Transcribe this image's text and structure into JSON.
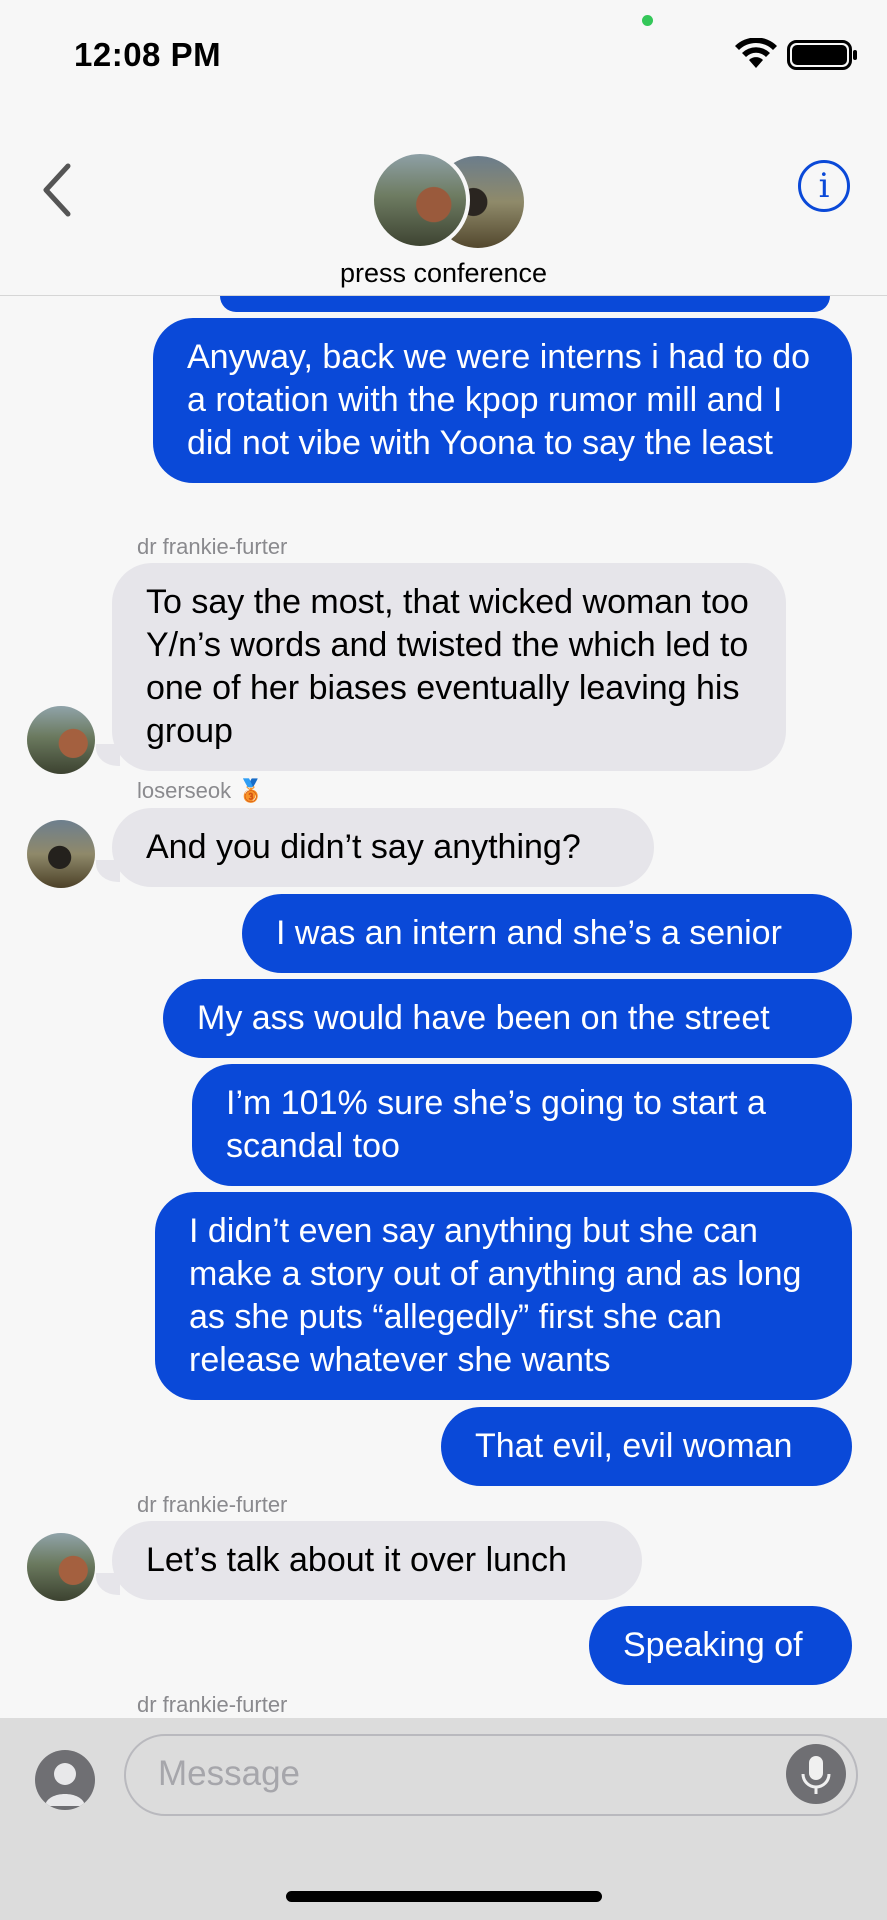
{
  "status": {
    "time": "12:08 PM"
  },
  "header": {
    "group_name": "press conference"
  },
  "messages": [
    {
      "text": "Anyway, back we were interns i had to do a rotation with the kpop rumor mill and I did not vibe with Yoona to say the least"
    },
    {
      "sender": "dr frankie-furter",
      "text": "To say the most, that wicked woman too Y/n’s words and twisted the which led to one of her biases eventually leaving his group"
    },
    {
      "sender": "loserseok",
      "sender_badge": "🥉",
      "text": "And you didn’t say anything?"
    },
    {
      "text": "I was an intern and she’s a senior"
    },
    {
      "text": "My ass would have been on the street"
    },
    {
      "text": "I’m 101% sure she’s going to start a scandal too"
    },
    {
      "text": "I didn’t even say anything but she can make a story out of anything and as long as she puts “allegedly” first she can release whatever she wants"
    },
    {
      "text": "That evil, evil woman"
    },
    {
      "sender": "dr frankie-furter",
      "text": "Let’s talk about it over lunch"
    },
    {
      "text": "Speaking of"
    },
    {
      "sender": "dr frankie-furter"
    }
  ],
  "input": {
    "placeholder": "Message"
  },
  "icons": {
    "back": "chevron-left-icon",
    "info": "info-icon",
    "mic": "microphone-icon",
    "camera": "avatar-icon"
  },
  "colors": {
    "outgoing": "#0a49d8",
    "incoming": "#e6e5ea",
    "accent": "#0a49d8"
  }
}
